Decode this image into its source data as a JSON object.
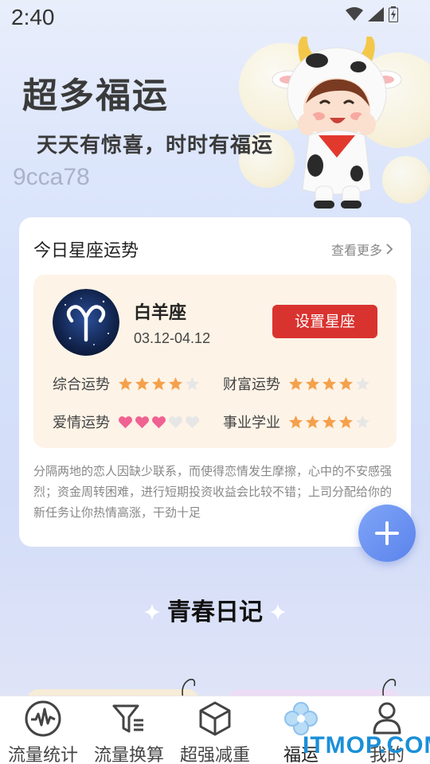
{
  "status_bar": {
    "time": "2:40"
  },
  "hero": {
    "title": "超多福运",
    "subtitle": "天天有惊喜，时时有福运",
    "watermark": "9cca78"
  },
  "horoscope": {
    "title": "今日星座运势",
    "more_label": "查看更多",
    "sign_name": "白羊座",
    "sign_date": "03.12-04.12",
    "set_button": "设置星座",
    "fortunes": [
      {
        "label": "综合运势",
        "icon": "star",
        "rating": 4,
        "max": 5
      },
      {
        "label": "财富运势",
        "icon": "star",
        "rating": 4,
        "max": 5
      },
      {
        "label": "爱情运势",
        "icon": "heart",
        "rating": 3,
        "max": 5
      },
      {
        "label": "事业学业",
        "icon": "star",
        "rating": 4,
        "max": 5
      }
    ],
    "description": "分隔两地的恋人因缺少联系，而使得恋情发生摩擦，心中的不安感强烈；资金周转困难，进行短期投资收益会比较不错；上司分配给你的新任务让你热情高涨，干劲十足"
  },
  "fab": {
    "icon": "plus-icon"
  },
  "section": {
    "title": "青春日记"
  },
  "tabs": [
    {
      "label": "流量统计",
      "icon": "waveform-icon",
      "active": false
    },
    {
      "label": "流量换算",
      "icon": "filter-icon",
      "active": false
    },
    {
      "label": "超强减重",
      "icon": "cube-icon",
      "active": false
    },
    {
      "label": "福运",
      "icon": "clover-icon",
      "active": true
    },
    {
      "label": "我的",
      "icon": "user-icon",
      "active": false
    }
  ],
  "brand_watermark": "ITMOP.COM",
  "colors": {
    "accent_red": "#d9332f",
    "fab_blue": "#5b83ec",
    "star_orange": "#f5a04b",
    "heart_pink": "#f06292",
    "active_tab": "#a9d2f4"
  }
}
